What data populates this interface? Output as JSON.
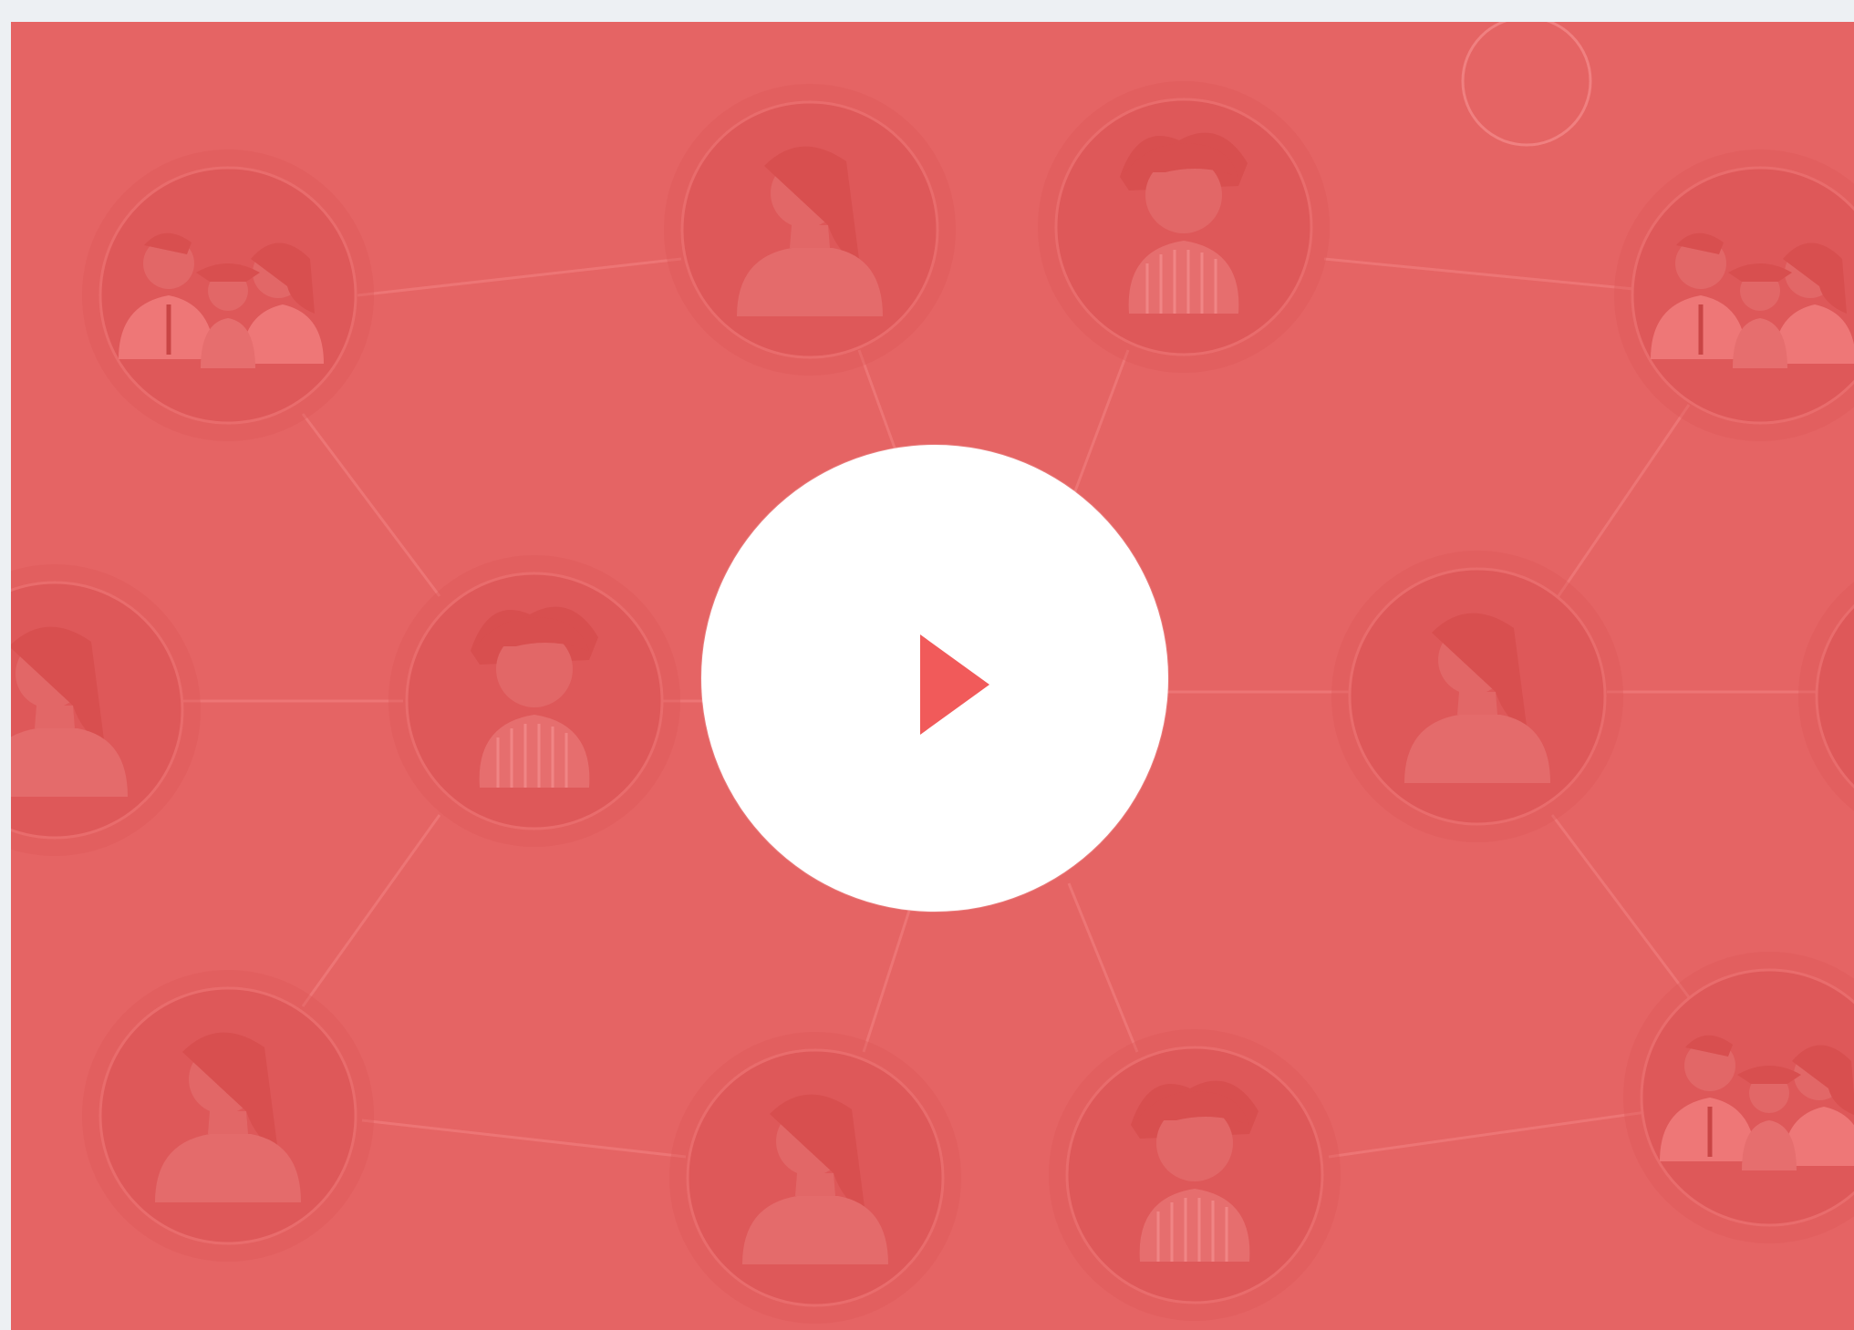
{
  "video": {
    "background_color": "#e56464",
    "accent_color": "#f15a5a",
    "play_button_color": "#ffffff",
    "play_icon": "play-icon",
    "network_icons": [
      "family-group-icon",
      "woman-avatar-icon",
      "girl-avatar-icon",
      "family-group-icon",
      "woman-avatar-icon",
      "girl-avatar-icon",
      "woman-avatar-icon",
      "woman-avatar-icon",
      "woman-avatar-icon",
      "woman-avatar-icon",
      "girl-avatar-icon",
      "family-group-icon"
    ]
  }
}
